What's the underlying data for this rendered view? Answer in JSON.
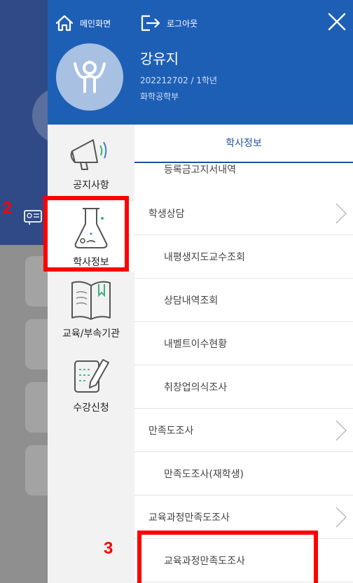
{
  "header": {
    "home_label": "메인화면",
    "logout_label": "로그아웃",
    "user_name": "강유지",
    "user_info": "202212702 / 1학년",
    "user_dept": "화학공학부"
  },
  "categories": [
    {
      "label": "공지사항",
      "icon": "megaphone-icon"
    },
    {
      "label": "학사정보",
      "icon": "flask-icon"
    },
    {
      "label": "교육/부속기관",
      "icon": "book-icon"
    },
    {
      "label": "수강신청",
      "icon": "pencil-note-icon"
    }
  ],
  "menu": {
    "title": "학사정보",
    "items": [
      {
        "label": "등록금고지서내역",
        "type": "sub"
      },
      {
        "label": "학생상담",
        "type": "group"
      },
      {
        "label": "내평생지도교수조회",
        "type": "sub"
      },
      {
        "label": "상담내역조회",
        "type": "sub"
      },
      {
        "label": "내벨트이수현황",
        "type": "sub"
      },
      {
        "label": "취창업의식조사",
        "type": "sub"
      },
      {
        "label": "만족도조사",
        "type": "group"
      },
      {
        "label": "만족도조사(재학생)",
        "type": "sub"
      },
      {
        "label": "교육과정만족도조사",
        "type": "group"
      },
      {
        "label": "교육과정만족도조사",
        "type": "sub"
      }
    ]
  },
  "annotations": {
    "step2": "2",
    "step3": "3",
    "color": "#ff0000"
  },
  "colors": {
    "header_bg": "#1e5fb6",
    "accent": "#1f4f9e"
  }
}
